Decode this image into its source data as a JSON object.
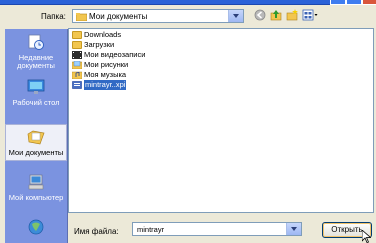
{
  "dialog": {
    "look_in_label": "Папка:",
    "look_in_value": "Мои документы"
  },
  "places": [
    {
      "label": "Недавние документы",
      "icon": "recent-documents-icon",
      "selected": false
    },
    {
      "label": "Рабочий стол",
      "icon": "desktop-icon",
      "selected": false
    },
    {
      "label": "Мои документы",
      "icon": "my-documents-icon",
      "selected": true
    },
    {
      "label": "Мой компьютер",
      "icon": "my-computer-icon",
      "selected": false
    },
    {
      "label": "",
      "icon": "network-places-icon",
      "selected": false
    }
  ],
  "files": [
    {
      "name": "Downloads",
      "type": "folder"
    },
    {
      "name": "Загрузки",
      "type": "folder"
    },
    {
      "name": "Мои видеозаписи",
      "type": "video-folder"
    },
    {
      "name": "Мои рисунки",
      "type": "pictures-folder"
    },
    {
      "name": "Моя музыка",
      "type": "music-folder"
    },
    {
      "name": "mintrayr..xpi",
      "type": "file",
      "selected": true
    }
  ],
  "filename": {
    "label": "Имя файла:",
    "value": "mintrayr"
  },
  "buttons": {
    "open": "Открыть"
  },
  "colors": {
    "places_bg": "#7b93e0",
    "selection": "#316ac5",
    "dialog_bg": "#ece9d8"
  }
}
